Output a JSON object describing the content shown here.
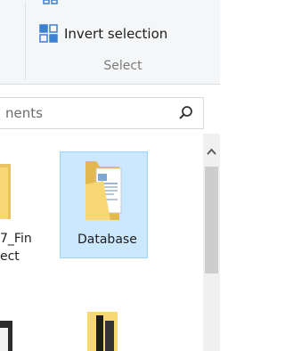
{
  "ribbon": {
    "invert_selection_label": "Invert selection",
    "group_label": "Select"
  },
  "search": {
    "value": "nents"
  },
  "items": [
    {
      "name_line1": "7_Fin",
      "name_line2": "ect",
      "icon": "folder-icon"
    },
    {
      "name": "Database",
      "icon": "folder-documents-icon",
      "selected": true
    }
  ],
  "colors": {
    "selection_fill": "#cce8ff",
    "selection_border": "#99d1ff",
    "folder_yellow": "#f8d775",
    "ribbon_bg": "#f5f6f7"
  }
}
